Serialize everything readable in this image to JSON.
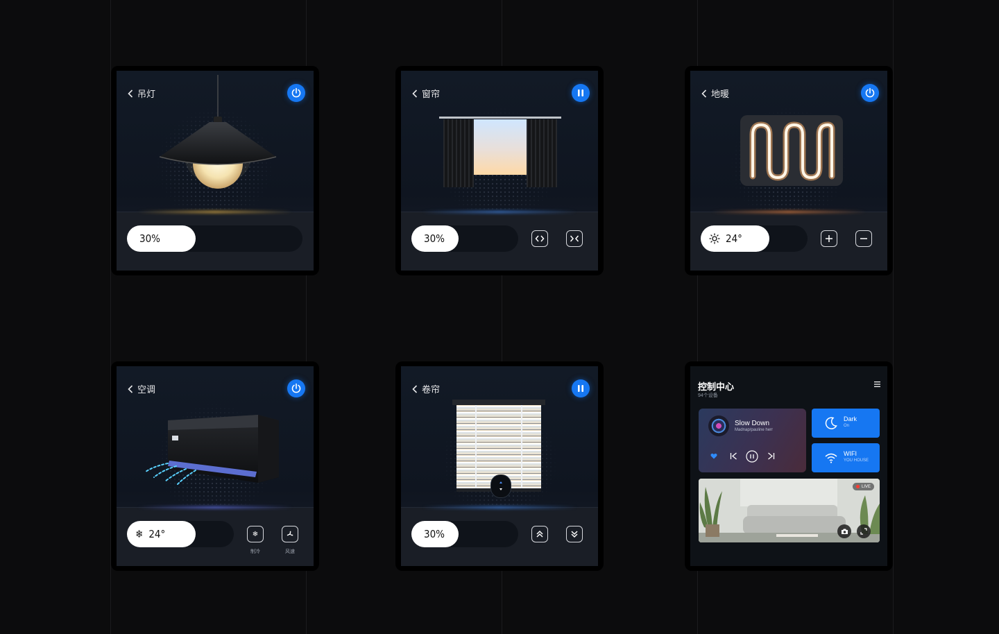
{
  "pendant_light": {
    "title": "吊灯",
    "brightness": "30%",
    "brightness_level": 0.3
  },
  "curtain": {
    "title": "窗帘",
    "position": "30%",
    "position_level": 0.3
  },
  "floor_heating": {
    "title": "地暖",
    "temperature": "24°"
  },
  "air_conditioner": {
    "title": "空调",
    "temperature": "24°",
    "mode_cool_label": "制冷",
    "fan_speed_label": "风速"
  },
  "roller_blind": {
    "title": "卷帘",
    "position": "30%",
    "position_level": 0.3
  },
  "control_center": {
    "title": "控制中心",
    "device_count": "94个设备",
    "music": {
      "track": "Slow Down",
      "artist": "Madnap/pauline herr"
    },
    "dark_tile": {
      "label": "Dark",
      "status": "On"
    },
    "wifi_tile": {
      "label": "WIFI",
      "status": "YOU HOUSE"
    },
    "camera_badge": "LIVE"
  },
  "colors": {
    "accent": "#1677f2",
    "background": "#0c0c0d"
  }
}
